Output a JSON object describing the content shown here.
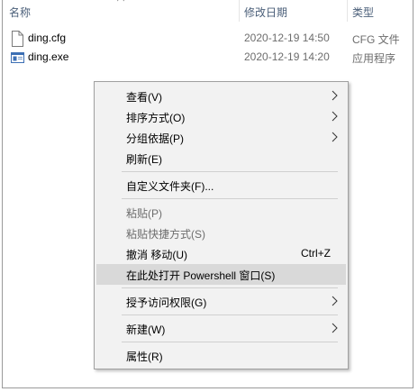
{
  "header": {
    "col_name": "名称",
    "col_date": "修改日期",
    "col_type": "类型"
  },
  "files": [
    {
      "name": "ding.cfg",
      "date": "2020-12-19 14:50",
      "type": "CFG 文件",
      "icon": "document-icon"
    },
    {
      "name": "ding.exe",
      "date": "2020-12-19 14:20",
      "type": "应用程序",
      "icon": "application-icon"
    }
  ],
  "context_menu": {
    "items": [
      {
        "label": "查看(V)",
        "submenu": true
      },
      {
        "label": "排序方式(O)",
        "submenu": true
      },
      {
        "label": "分组依据(P)",
        "submenu": true
      },
      {
        "label": "刷新(E)"
      },
      {
        "label": "自定义文件夹(F)..."
      },
      {
        "label": "粘贴(P)",
        "disabled": true
      },
      {
        "label": "粘贴快捷方式(S)",
        "disabled": true
      },
      {
        "label": "撤消 移动(U)",
        "shortcut": "Ctrl+Z"
      },
      {
        "label": "在此处打开 Powershell 窗口(S)",
        "highlighted": true
      },
      {
        "label": "授予访问权限(G)",
        "submenu": true
      },
      {
        "label": "新建(W)",
        "submenu": true
      },
      {
        "label": "属性(R)"
      }
    ]
  },
  "colors": {
    "header_text": "#4c607a",
    "menu_bg": "#f2f2f2",
    "highlight_bg": "#d9d9d9",
    "disabled_text": "#6d6d6d"
  }
}
